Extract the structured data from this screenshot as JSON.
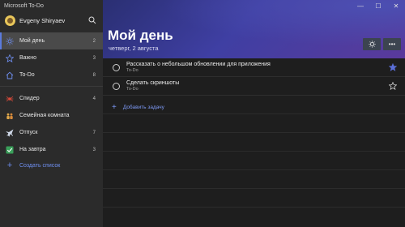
{
  "window": {
    "title": "Microsoft To-Do",
    "controls": {
      "minimize": "—",
      "maximize": "☐",
      "close": "✕"
    }
  },
  "colors": {
    "accent": "#5b7bdc",
    "star_filled": "#5b6fd8",
    "header_gradient_start": "#2a2f72",
    "header_gradient_end": "#5a3a9c"
  },
  "account": {
    "name": "Evgeny Shiryaev",
    "avatar_icon": "avatar-icon",
    "search_icon": "search-icon"
  },
  "sidebar": {
    "primary": [
      {
        "label": "Мой день",
        "count": "2",
        "icon": "sun-icon",
        "active": true
      },
      {
        "label": "Важно",
        "count": "3",
        "icon": "star-icon",
        "active": false
      },
      {
        "label": "To-Do",
        "count": "8",
        "icon": "home-icon",
        "active": false
      }
    ],
    "lists": [
      {
        "label": "Спидер",
        "count": "4",
        "icon": "spider-icon"
      },
      {
        "label": "Семейная комната",
        "count": "",
        "icon": "family-icon"
      },
      {
        "label": "Отпуск",
        "count": "7",
        "icon": "plane-icon"
      },
      {
        "label": "На завтра",
        "count": "3",
        "icon": "check-icon"
      }
    ],
    "create_list": {
      "label": "Создать список",
      "icon": "plus-icon"
    }
  },
  "main": {
    "title": "Мой день",
    "date": "четверг, 2 августа",
    "actions": [
      {
        "icon": "lightbulb-icon"
      },
      {
        "icon": "more-icon",
        "label": "•••"
      }
    ],
    "tasks": [
      {
        "title": "Рассказать о небольшом обновлении для приложения",
        "list": "To-Do",
        "starred": true
      },
      {
        "title": "Сделать скриншоты",
        "list": "To-Do",
        "starred": false
      }
    ],
    "add_task": {
      "label": "Добавить задачу",
      "icon": "plus-icon"
    }
  }
}
